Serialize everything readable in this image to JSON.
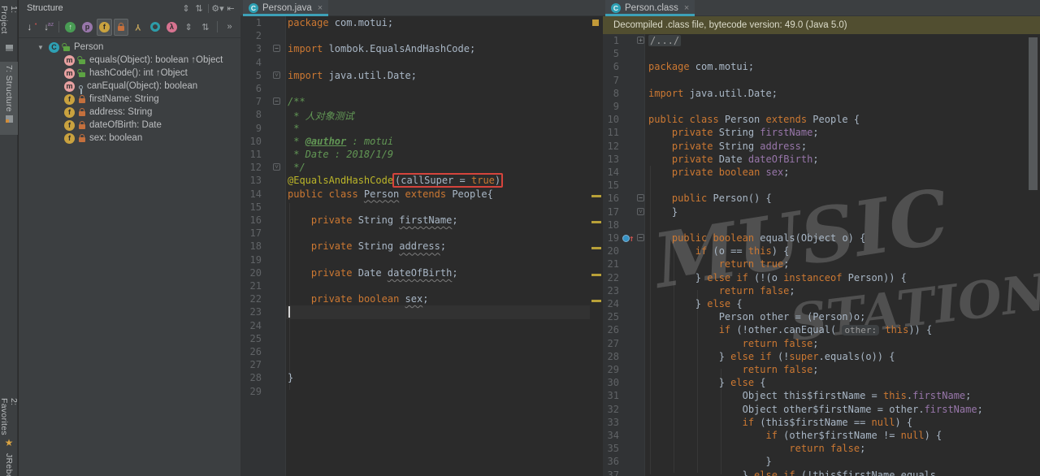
{
  "left_bar": {
    "top": [
      {
        "id": "project",
        "label": "1: Project",
        "active": false
      },
      {
        "id": "structure",
        "label": "7: Structure",
        "active": true
      }
    ],
    "bottom": [
      {
        "id": "favorites",
        "label": "2: Favorites",
        "active": false
      },
      {
        "id": "jrebel",
        "label": "JRebel",
        "active": false
      }
    ]
  },
  "structure_panel": {
    "title": "Structure",
    "header_icons": [
      {
        "name": "expand-all-icon",
        "glyph": "⇕"
      },
      {
        "name": "collapse-all-icon",
        "glyph": "⇅"
      },
      {
        "name": "separator",
        "glyph": ""
      },
      {
        "name": "settings-gear-icon",
        "glyph": "⚙▾"
      },
      {
        "name": "hide-panel-icon",
        "glyph": "⇤"
      }
    ],
    "toolbar_icons": [
      {
        "name": "sort-by-visibility-icon",
        "kind": "garrow",
        "glyph": "↓",
        "sub": "•",
        "subcolor": "#c75450"
      },
      {
        "name": "sort-alphabetically-icon",
        "kind": "garrow",
        "glyph": "↓",
        "sub": "az",
        "subcolor": "#9876aa"
      },
      {
        "name": "separator",
        "kind": "sep"
      },
      {
        "name": "show-inherited-icon",
        "kind": "circle",
        "bg": "#499c54",
        "glyph": "↑",
        "fg": "#eaf2ea",
        "active": false
      },
      {
        "name": "show-properties-icon",
        "kind": "circle",
        "bg": "#9876aa",
        "glyph": "p",
        "fg": "#2b2b2b",
        "active": false
      },
      {
        "name": "show-fields-icon",
        "kind": "circle",
        "bg": "#c9a23f",
        "glyph": "f",
        "fg": "#2b2b2b",
        "active": true
      },
      {
        "name": "show-non-public-icon",
        "kind": "lock",
        "active": true
      },
      {
        "name": "anonymous-classes-icon",
        "kind": "flipY",
        "glyph": "Y",
        "active": false
      },
      {
        "name": "show-inner-classes-icon",
        "kind": "ring",
        "active": false
      },
      {
        "name": "show-lambdas-icon",
        "kind": "circle",
        "bg": "#d77390",
        "glyph": "λ",
        "fg": "#2b2b2b",
        "active": false
      },
      {
        "name": "expand-all-icon",
        "kind": "glyph",
        "glyph": "⇕",
        "active": false
      },
      {
        "name": "collapse-all-icon",
        "kind": "glyph",
        "glyph": "⇅",
        "active": false
      },
      {
        "name": "separator",
        "kind": "sep"
      },
      {
        "name": "overflow-chevron-icon",
        "kind": "glyph",
        "glyph": "»",
        "active": false
      }
    ],
    "tree": [
      {
        "icon": "class",
        "vis": "public",
        "label": "Person",
        "expanded": true,
        "root": true
      },
      {
        "icon": "method",
        "vis": "public",
        "label": "equals(Object): boolean ↑Object"
      },
      {
        "icon": "method",
        "vis": "public",
        "label": "hashCode(): int ↑Object"
      },
      {
        "icon": "method",
        "vis": "protected",
        "label": "canEqual(Object): boolean"
      },
      {
        "icon": "field",
        "vis": "private",
        "label": "firstName: String"
      },
      {
        "icon": "field",
        "vis": "private",
        "label": "address: String"
      },
      {
        "icon": "field",
        "vis": "private",
        "label": "dateOfBirth: Date"
      },
      {
        "icon": "field",
        "vis": "private",
        "label": "sex: boolean"
      }
    ]
  },
  "editor_java": {
    "tab": "Person.java",
    "tab_icon": "C",
    "close_glyph": "×",
    "cursor_line": 23,
    "stripe_marks": [
      14,
      16,
      18,
      20,
      22
    ],
    "lines": [
      {
        "n": 1,
        "seg": [
          [
            "kw",
            "package"
          ],
          [
            "pl",
            " com.motui;"
          ]
        ]
      },
      {
        "n": 2,
        "seg": []
      },
      {
        "n": 3,
        "fm": "start",
        "seg": [
          [
            "kw",
            "import"
          ],
          [
            "pl",
            " lombok.EqualsAndHashCode;"
          ]
        ]
      },
      {
        "n": 4,
        "seg": []
      },
      {
        "n": 5,
        "fm": "end",
        "seg": [
          [
            "kw",
            "import"
          ],
          [
            "pl",
            " java.util.Date;"
          ]
        ]
      },
      {
        "n": 6,
        "seg": []
      },
      {
        "n": 7,
        "fm": "start",
        "seg": [
          [
            "dc",
            "/**"
          ]
        ]
      },
      {
        "n": 8,
        "seg": [
          [
            "dc",
            " * 人对象测试"
          ]
        ]
      },
      {
        "n": 9,
        "seg": [
          [
            "dc",
            " *"
          ]
        ]
      },
      {
        "n": 10,
        "seg": [
          [
            "dc",
            " * "
          ],
          [
            "dt",
            "@author"
          ],
          [
            "dc",
            " : motui"
          ]
        ]
      },
      {
        "n": 11,
        "seg": [
          [
            "dc",
            " * Date : 2018/1/9"
          ]
        ]
      },
      {
        "n": 12,
        "fm": "end",
        "seg": [
          [
            "dc",
            " */"
          ]
        ]
      },
      {
        "n": 13,
        "seg": [
          [
            "ann",
            "@EqualsAndHashCode"
          ],
          [
            "box",
            [
              [
                "pl",
                "("
              ],
              [
                "pl",
                "callSuper"
              ],
              [
                "pl",
                " = "
              ],
              [
                "kw",
                "true"
              ],
              [
                "pl",
                ")"
              ]
            ]
          ]
        ]
      },
      {
        "n": 14,
        "seg": [
          [
            "kw",
            "public class "
          ],
          [
            "wv",
            "Person"
          ],
          [
            "kw",
            " extends "
          ],
          [
            "pl",
            "People{"
          ]
        ]
      },
      {
        "n": 15,
        "seg": []
      },
      {
        "n": 16,
        "seg": [
          [
            "pl",
            "    "
          ],
          [
            "kw",
            "private"
          ],
          [
            "pl",
            " String "
          ],
          [
            "wv",
            "firstName"
          ],
          [
            "pl",
            ";"
          ]
        ]
      },
      {
        "n": 17,
        "seg": []
      },
      {
        "n": 18,
        "seg": [
          [
            "pl",
            "    "
          ],
          [
            "kw",
            "private"
          ],
          [
            "pl",
            " String "
          ],
          [
            "wv",
            "address"
          ],
          [
            "pl",
            ";"
          ]
        ]
      },
      {
        "n": 19,
        "seg": []
      },
      {
        "n": 20,
        "seg": [
          [
            "pl",
            "    "
          ],
          [
            "kw",
            "private"
          ],
          [
            "pl",
            " Date "
          ],
          [
            "wv",
            "dateOfBirth"
          ],
          [
            "pl",
            ";"
          ]
        ]
      },
      {
        "n": 21,
        "seg": []
      },
      {
        "n": 22,
        "seg": [
          [
            "pl",
            "    "
          ],
          [
            "kw",
            "private"
          ],
          [
            "pl",
            " "
          ],
          [
            "kw",
            "boolean"
          ],
          [
            "pl",
            " "
          ],
          [
            "wv",
            "sex"
          ],
          [
            "pl",
            ";"
          ]
        ]
      },
      {
        "n": 23,
        "seg": []
      },
      {
        "n": 24,
        "seg": []
      },
      {
        "n": 25,
        "seg": []
      },
      {
        "n": 26,
        "seg": []
      },
      {
        "n": 27,
        "seg": []
      },
      {
        "n": 28,
        "seg": [
          [
            "pl",
            "}"
          ]
        ]
      },
      {
        "n": 29,
        "seg": []
      }
    ]
  },
  "editor_class": {
    "tab": "Person.class",
    "tab_icon": "C",
    "close_glyph": "×",
    "banner": "Decompiled .class file, bytecode version: 49.0 (Java 5.0)",
    "watermark": {
      "word1": "MUSIC",
      "word2": "STATION"
    },
    "lines": [
      {
        "n": 1,
        "fm": "plus",
        "seg": [
          [
            "foldtxt",
            "/.../"
          ]
        ]
      },
      {
        "n": 5,
        "seg": []
      },
      {
        "n": 6,
        "seg": [
          [
            "kw",
            "package"
          ],
          [
            "pl",
            " com.motui;"
          ]
        ]
      },
      {
        "n": 7,
        "seg": []
      },
      {
        "n": 8,
        "seg": [
          [
            "kw",
            "import"
          ],
          [
            "pl",
            " java.util.Date;"
          ]
        ]
      },
      {
        "n": 9,
        "seg": []
      },
      {
        "n": 10,
        "seg": [
          [
            "kw",
            "public class "
          ],
          [
            "pl",
            "Person "
          ],
          [
            "kw",
            "extends"
          ],
          [
            "pl",
            " People {"
          ]
        ]
      },
      {
        "n": 11,
        "seg": [
          [
            "pl",
            "    "
          ],
          [
            "kw",
            "private"
          ],
          [
            "pl",
            " String "
          ],
          [
            "fd",
            "firstName"
          ],
          [
            "pl",
            ";"
          ]
        ]
      },
      {
        "n": 12,
        "seg": [
          [
            "pl",
            "    "
          ],
          [
            "kw",
            "private"
          ],
          [
            "pl",
            " String "
          ],
          [
            "fd",
            "address"
          ],
          [
            "pl",
            ";"
          ]
        ]
      },
      {
        "n": 13,
        "seg": [
          [
            "pl",
            "    "
          ],
          [
            "kw",
            "private"
          ],
          [
            "pl",
            " Date "
          ],
          [
            "fd",
            "dateOfBirth"
          ],
          [
            "pl",
            ";"
          ]
        ]
      },
      {
        "n": 14,
        "seg": [
          [
            "pl",
            "    "
          ],
          [
            "kw",
            "private"
          ],
          [
            "pl",
            " "
          ],
          [
            "kw",
            "boolean"
          ],
          [
            "pl",
            " "
          ],
          [
            "fd",
            "sex"
          ],
          [
            "pl",
            ";"
          ]
        ]
      },
      {
        "n": 15,
        "seg": []
      },
      {
        "n": 16,
        "fm": "start",
        "seg": [
          [
            "pl",
            "    "
          ],
          [
            "kw",
            "public"
          ],
          [
            "pl",
            " Person() {"
          ]
        ]
      },
      {
        "n": 17,
        "fm": "end",
        "seg": [
          [
            "pl",
            "    }"
          ]
        ]
      },
      {
        "n": 18,
        "seg": []
      },
      {
        "n": 19,
        "fm": "start",
        "gi": "override",
        "seg": [
          [
            "pl",
            "    "
          ],
          [
            "kw",
            "public"
          ],
          [
            "pl",
            " "
          ],
          [
            "kw",
            "boolean"
          ],
          [
            "pl",
            " equals(Object o) {"
          ]
        ]
      },
      {
        "n": 20,
        "seg": [
          [
            "pl",
            "        "
          ],
          [
            "kw",
            "if"
          ],
          [
            "pl",
            " (o == "
          ],
          [
            "kw",
            "this"
          ],
          [
            "pl",
            ") {"
          ]
        ]
      },
      {
        "n": 21,
        "seg": [
          [
            "pl",
            "            "
          ],
          [
            "kw",
            "return true"
          ],
          [
            "pl",
            ";"
          ]
        ]
      },
      {
        "n": 22,
        "seg": [
          [
            "pl",
            "        } "
          ],
          [
            "kw",
            "else if"
          ],
          [
            "pl",
            " (!(o "
          ],
          [
            "kw",
            "instanceof"
          ],
          [
            "pl",
            " Person)) {"
          ]
        ]
      },
      {
        "n": 23,
        "seg": [
          [
            "pl",
            "            "
          ],
          [
            "kw",
            "return false"
          ],
          [
            "pl",
            ";"
          ]
        ]
      },
      {
        "n": 24,
        "seg": [
          [
            "pl",
            "        } "
          ],
          [
            "kw",
            "else"
          ],
          [
            "pl",
            " {"
          ]
        ]
      },
      {
        "n": 25,
        "seg": [
          [
            "pl",
            "            Person other = (Person)o;"
          ]
        ]
      },
      {
        "n": 26,
        "seg": [
          [
            "pl",
            "            "
          ],
          [
            "kw",
            "if"
          ],
          [
            "pl",
            " (!other.canEqual( "
          ],
          [
            "hint",
            "other:"
          ],
          [
            "pl",
            " "
          ],
          [
            "kw",
            "this"
          ],
          [
            "pl",
            ")) {"
          ]
        ]
      },
      {
        "n": 27,
        "seg": [
          [
            "pl",
            "                "
          ],
          [
            "kw",
            "return false"
          ],
          [
            "pl",
            ";"
          ]
        ]
      },
      {
        "n": 28,
        "seg": [
          [
            "pl",
            "            } "
          ],
          [
            "kw",
            "else if"
          ],
          [
            "pl",
            " (!"
          ],
          [
            "kw",
            "super"
          ],
          [
            "pl",
            ".equals(o)) {"
          ]
        ]
      },
      {
        "n": 29,
        "seg": [
          [
            "pl",
            "                "
          ],
          [
            "kw",
            "return false"
          ],
          [
            "pl",
            ";"
          ]
        ]
      },
      {
        "n": 30,
        "seg": [
          [
            "pl",
            "            } "
          ],
          [
            "kw",
            "else"
          ],
          [
            "pl",
            " {"
          ]
        ]
      },
      {
        "n": 31,
        "seg": [
          [
            "pl",
            "                Object this$firstName = "
          ],
          [
            "kw",
            "this"
          ],
          [
            "pl",
            "."
          ],
          [
            "fd",
            "firstName"
          ],
          [
            "pl",
            ";"
          ]
        ]
      },
      {
        "n": 32,
        "seg": [
          [
            "pl",
            "                Object other$firstName = other."
          ],
          [
            "fd",
            "firstName"
          ],
          [
            "pl",
            ";"
          ]
        ]
      },
      {
        "n": 33,
        "seg": [
          [
            "pl",
            "                "
          ],
          [
            "kw",
            "if"
          ],
          [
            "pl",
            " (this$firstName == "
          ],
          [
            "kw",
            "null"
          ],
          [
            "pl",
            ") {"
          ]
        ]
      },
      {
        "n": 34,
        "seg": [
          [
            "pl",
            "                    "
          ],
          [
            "kw",
            "if"
          ],
          [
            "pl",
            " (other$firstName != "
          ],
          [
            "kw",
            "null"
          ],
          [
            "pl",
            ") {"
          ]
        ]
      },
      {
        "n": 35,
        "seg": [
          [
            "pl",
            "                        "
          ],
          [
            "kw",
            "return false"
          ],
          [
            "pl",
            ";"
          ]
        ]
      },
      {
        "n": 36,
        "seg": [
          [
            "pl",
            "                    }"
          ]
        ]
      },
      {
        "n": 37,
        "seg": [
          [
            "pl",
            "                } "
          ],
          [
            "kw",
            "else if"
          ],
          [
            "pl",
            " (!this$firstName.equals"
          ]
        ]
      }
    ]
  }
}
